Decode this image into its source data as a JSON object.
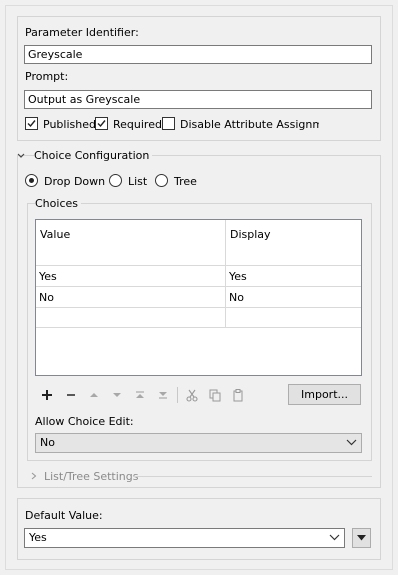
{
  "parameter": {
    "identifier_label": "Parameter Identifier:",
    "identifier_value": "Greyscale",
    "prompt_label": "Prompt:",
    "prompt_value": "Output as Greyscale",
    "published_label": "Published",
    "published_checked": true,
    "required_label": "Required",
    "required_checked": true,
    "disable_attr_label": "Disable Attribute Assignment",
    "disable_attr_checked": false
  },
  "choice_config": {
    "header": "Choice Configuration",
    "radio_options": [
      "Drop Down",
      "List",
      "Tree"
    ],
    "selected": "Drop Down",
    "choices_label": "Choices",
    "table": {
      "columns": [
        "Value",
        "Display"
      ],
      "rows": [
        [
          "Yes",
          "Yes"
        ],
        [
          "No",
          "No"
        ]
      ]
    },
    "import_button": "Import...",
    "allow_edit_label": "Allow Choice Edit:",
    "allow_edit_value": "No",
    "list_tree_settings": "List/Tree Settings"
  },
  "default": {
    "label": "Default Value:",
    "value": "Yes"
  },
  "icons": [
    "plus-icon",
    "minus-icon",
    "move-up-icon",
    "move-down-icon",
    "move-top-icon",
    "move-bottom-icon",
    "cut-icon",
    "copy-icon",
    "paste-icon",
    "chevron-down-icon",
    "chevron-right-icon",
    "dropdown-arrow-icon"
  ]
}
